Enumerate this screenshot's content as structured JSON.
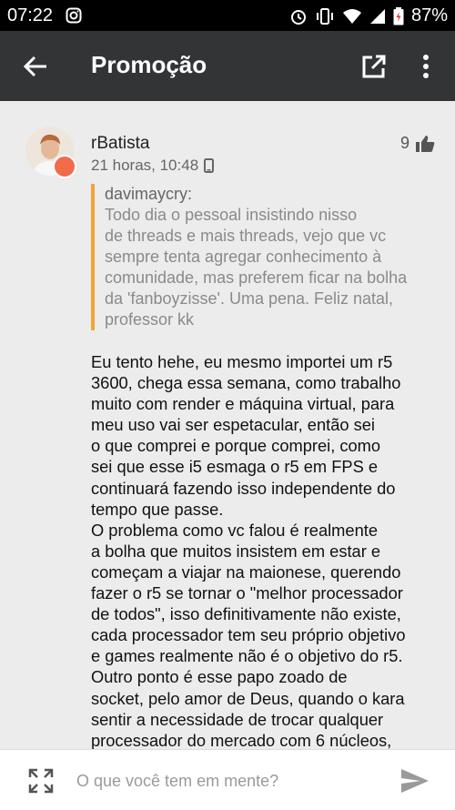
{
  "status_bar": {
    "time": "07:22",
    "battery": "87%"
  },
  "app_bar": {
    "title": "Promoção"
  },
  "post": {
    "author": "rBatista",
    "timestamp": "21 horas, 10:48",
    "likes": "9",
    "quote": {
      "author": "davimaycry:",
      "lines": [
        "Todo dia o pessoal insistindo nisso",
        "de threads e mais threads, vejo que vc",
        "sempre tenta agregar conhecimento à",
        "comunidade, mas preferem ficar na bolha",
        "da 'fanboyzisse'. Uma pena. Feliz natal,",
        "professor kk"
      ]
    },
    "body_lines": [
      "Eu tento hehe, eu mesmo importei um r5",
      "3600, chega essa semana, como trabalho",
      "muito com render e máquina virtual, para",
      "meu uso vai ser espetacular, então sei",
      "o que comprei e porque comprei, como",
      "sei que esse i5 esmaga o r5 em FPS e",
      "continuará fazendo isso independente do",
      "tempo que passe.",
      "O problema como vc falou é realmente",
      "a bolha que muitos insistem em estar e",
      "começam a viajar na maionese, querendo",
      "fazer o r5 se tornar o \"melhor processador",
      "de todos\", isso definitivamente não existe,",
      "cada processador tem seu próprio objetivo",
      "e games realmente não é o objetivo do r5.",
      "Outro ponto é esse papo zoado de",
      "socket, pelo amor de Deus, quando o kara",
      "sentir a necessidade de trocar qualquer",
      "processador do mercado com 6 núcleos,"
    ]
  },
  "composer": {
    "placeholder": "O que você tem em mente?"
  },
  "icons": {
    "back": "arrow-left-icon",
    "open": "open-in-new-icon",
    "more": "more-vert-icon",
    "like": "thumbs-up-icon",
    "device": "phone-icon",
    "expand": "expand-icon",
    "send": "send-icon"
  },
  "colors": {
    "app_bar": "#333436",
    "quote_border": "#f4a23a",
    "badge": "#f26b4b"
  }
}
